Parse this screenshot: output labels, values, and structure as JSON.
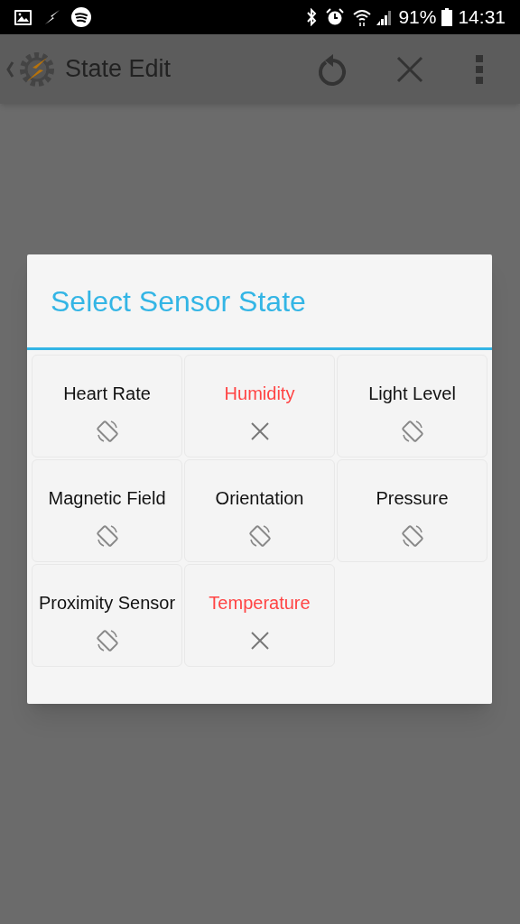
{
  "status_bar": {
    "battery": "91%",
    "time": "14:31"
  },
  "app_bar": {
    "title": "State Edit"
  },
  "dialog": {
    "title": "Select Sensor State",
    "sensors": [
      {
        "label": "Heart Rate",
        "available": true
      },
      {
        "label": "Humidity",
        "available": false
      },
      {
        "label": "Light Level",
        "available": true
      },
      {
        "label": "Magnetic Field",
        "available": true
      },
      {
        "label": "Orientation",
        "available": true
      },
      {
        "label": "Pressure",
        "available": true
      },
      {
        "label": "Proximity Sensor",
        "available": true
      },
      {
        "label": "Temperature",
        "available": false
      }
    ]
  }
}
